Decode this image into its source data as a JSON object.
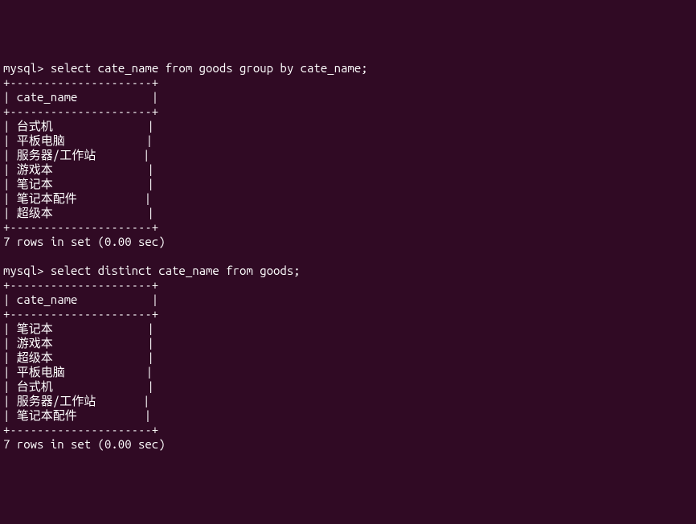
{
  "query1": {
    "prompt": "mysql> ",
    "sql": "select cate_name from goods group by cate_name;",
    "border_top": "+---------------------+",
    "header_label": "cate_name",
    "header_row": "| cate_name           |",
    "border_mid": "+---------------------+",
    "rows": [
      "| 台式机              |",
      "| 平板电脑            |",
      "| 服务器/工作站       |",
      "| 游戏本              |",
      "| 笔记本              |",
      "| 笔记本配件          |",
      "| 超级本              |"
    ],
    "border_bottom": "+---------------------+",
    "summary": "7 rows in set (0.00 sec)"
  },
  "query2": {
    "prompt": "mysql> ",
    "sql": "select distinct cate_name from goods;",
    "border_top": "+---------------------+",
    "header_label": "cate_name",
    "header_row": "| cate_name           |",
    "border_mid": "+---------------------+",
    "rows": [
      "| 笔记本              |",
      "| 游戏本              |",
      "| 超级本              |",
      "| 平板电脑            |",
      "| 台式机              |",
      "| 服务器/工作站       |",
      "| 笔记本配件          |"
    ],
    "border_bottom": "+---------------------+",
    "summary": "7 rows in set (0.00 sec)"
  }
}
